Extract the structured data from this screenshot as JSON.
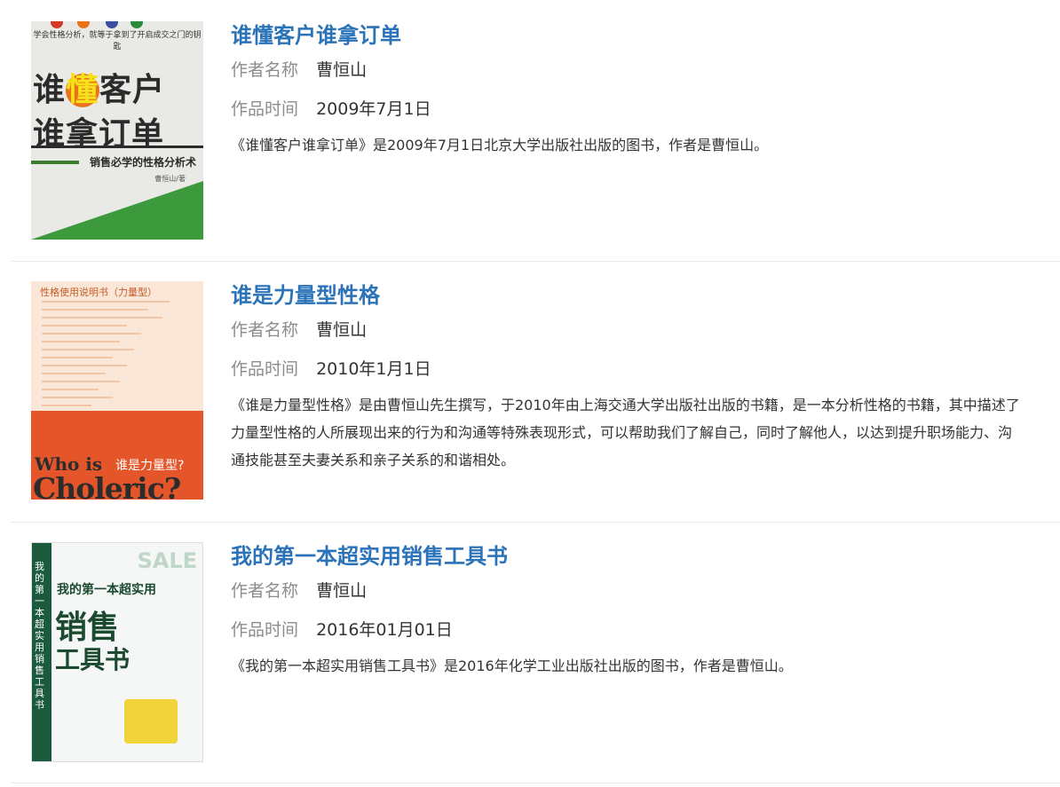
{
  "labels": {
    "author": "作者名称",
    "time": "作品时间"
  },
  "items": [
    {
      "title": "谁懂客户谁拿订单",
      "author": "曹恒山",
      "date": "2009年7月1日",
      "desc": "《谁懂客户谁拿订单》是2009年7月1日北京大学出版社出版的图书，作者是曹恒山。",
      "cover": {
        "top": "学会性格分析，就等于拿到了开启成交之门的钥匙",
        "line1a": "谁",
        "line1b": "懂",
        "line1c": "客户",
        "line2": "谁拿订单",
        "sub": "销售必学的性格分析术",
        "auth": "曹恒山/著"
      }
    },
    {
      "title": "谁是力量型性格",
      "author": "曹恒山",
      "date": "2010年1月1日",
      "desc": "《谁是力量型性格》是由曹恒山先生撰写，于2010年由上海交通大学出版社出版的书籍，是一本分析性格的书籍，其中描述了力量型性格的人所展现出来的行为和沟通等特殊表现形式，可以帮助我们了解自己，同时了解他人，以达到提升职场能力、沟通技能甚至夫妻关系和亲子关系的和谐相处。",
      "cover": {
        "hdr": "性格使用说明书（力量型）",
        "who": "Who is",
        "whocn": "谁是力量型?",
        "chol": "Choleric?"
      }
    },
    {
      "title": "我的第一本超实用销售工具书",
      "author": "曹恒山",
      "date": "2016年01月01日",
      "desc": "《我的第一本超实用销售工具书》是2016年化学工业出版社出版的图书，作者是曹恒山。",
      "cover": {
        "spine": "我的第一本超实用销售工具书",
        "sale": "SALE",
        "t1": "我的第一本超实用",
        "t2": "销售",
        "t3": "工具书"
      }
    }
  ]
}
